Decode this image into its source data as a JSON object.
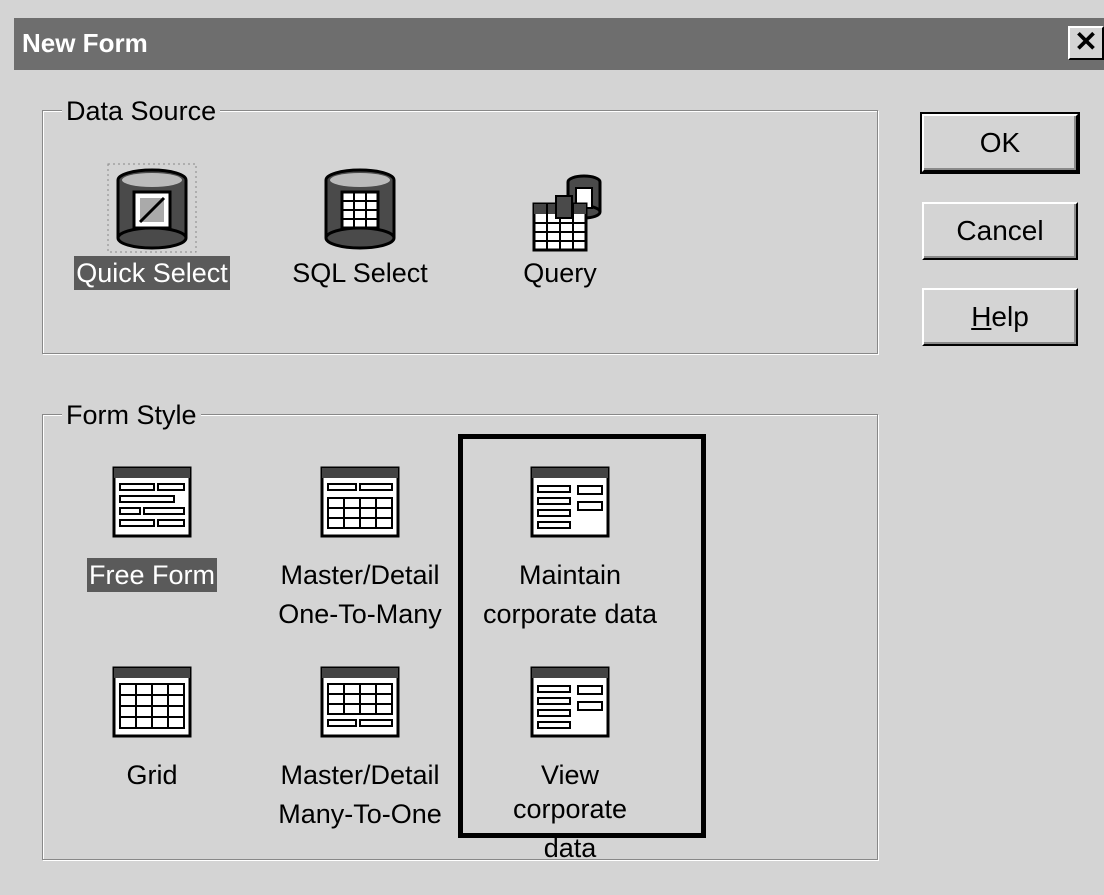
{
  "window": {
    "title": "New Form",
    "close_glyph": "✕"
  },
  "data_source": {
    "legend": "Data Source",
    "items": [
      {
        "label": "Quick Select",
        "icon": "database-form-icon",
        "selected": true
      },
      {
        "label": "SQL Select",
        "icon": "database-table-icon",
        "selected": false
      },
      {
        "label": "Query",
        "icon": "query-grid-icon",
        "selected": false
      }
    ]
  },
  "form_style": {
    "legend": "Form Style",
    "items": [
      {
        "line1": "Free Form",
        "line2": "",
        "icon": "free-form-icon",
        "selected": true
      },
      {
        "line1": "Master/Detail",
        "line2": "One-To-Many",
        "icon": "master-detail-one-to-many-icon",
        "selected": false
      },
      {
        "line1": "Maintain",
        "line2": "corporate data",
        "icon": "maintain-form-icon",
        "selected": false
      },
      {
        "line1": "Grid",
        "line2": "",
        "icon": "grid-icon",
        "selected": false
      },
      {
        "line1": "Master/Detail",
        "line2": "Many-To-One",
        "icon": "master-detail-many-to-one-icon",
        "selected": false
      },
      {
        "line1": "View corporate",
        "line2": "data",
        "icon": "view-form-icon",
        "selected": false
      }
    ]
  },
  "buttons": {
    "ok": "OK",
    "cancel": "Cancel",
    "help_underlined": "H",
    "help_rest": "elp"
  }
}
